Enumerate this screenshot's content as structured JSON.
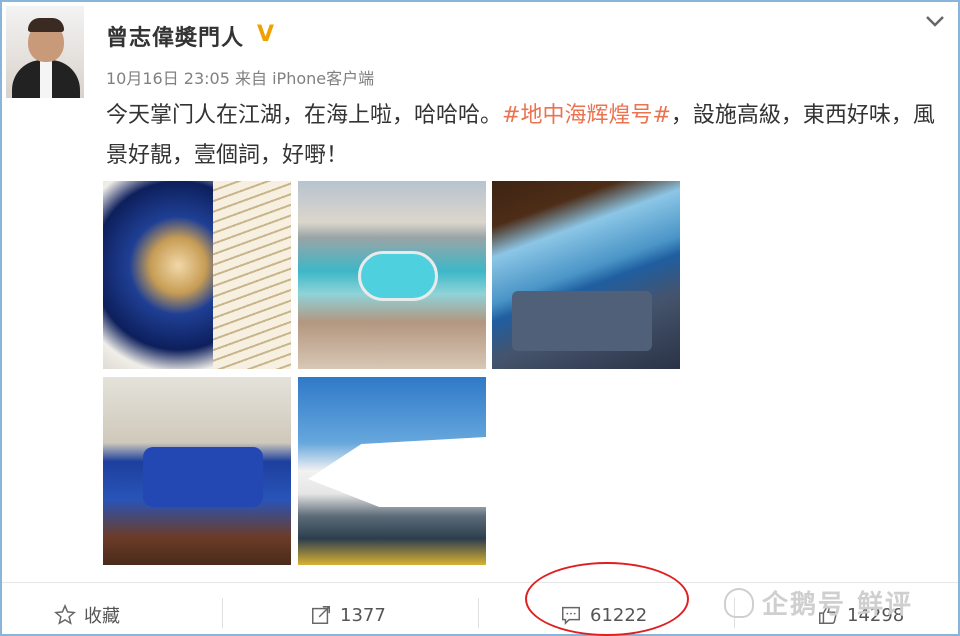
{
  "post": {
    "username": "曾志偉奬門人",
    "verified_badge": "V",
    "timestamp": "10月16日 23:05",
    "source": "来自 iPhone客户端",
    "text_before": "今天掌门人在江湖，在海上啦，哈哈哈。",
    "hashtag": "#地中海辉煌号#",
    "text_after": "，設施高級，東西好味，風景好靚，壹個詞，好嘢！",
    "images": [
      {
        "icon": "staircase-photo"
      },
      {
        "icon": "pool-deck-photo"
      },
      {
        "icon": "lounge-photo"
      },
      {
        "icon": "cabin-sofa-photo"
      },
      {
        "icon": "cruise-ship-photo"
      }
    ]
  },
  "actions": {
    "favorite_label": "收藏",
    "repost_count": "1377",
    "comment_count": "61222",
    "like_count": "14298"
  },
  "watermark": {
    "text": "企鹅号 鲜评"
  },
  "colors": {
    "hashtag": "#eb7350",
    "verified": "#f0a000",
    "highlight_circle": "#e02020",
    "card_border": "#8ab4d8"
  }
}
